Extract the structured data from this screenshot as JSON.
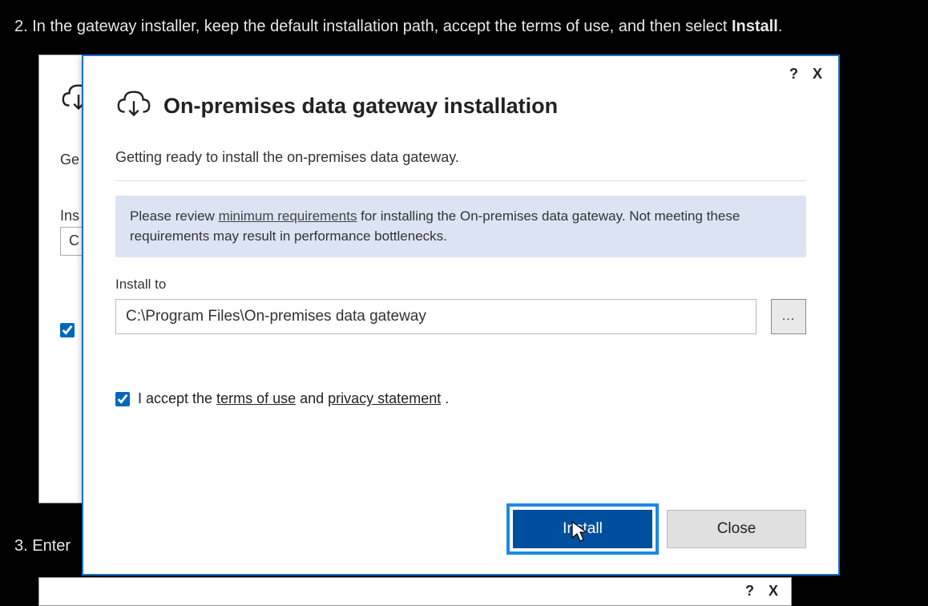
{
  "instructions": {
    "step2_prefix": "2. In the gateway installer, keep the default installation path, accept the terms of use, and then select ",
    "step2_bold": "Install",
    "step2_suffix": ".",
    "step3": "3. Enter"
  },
  "bgWindow": {
    "readyText": "Ge",
    "installLabel": "Ins",
    "pathValue": "C"
  },
  "bgWindow2": {
    "help": "?",
    "close": "X"
  },
  "dialog": {
    "titlebar": {
      "help": "?",
      "close": "X"
    },
    "title": "On-premises data gateway installation",
    "subtitle": "Getting ready to install the on-premises data gateway.",
    "info": {
      "prefix": "Please review  ",
      "link": "minimum requirements",
      "suffix": " for installing the On-premises data gateway. Not meeting these requirements may result in performance bottlenecks."
    },
    "installTo": {
      "label": "Install to",
      "path": "C:\\Program Files\\On-premises data gateway",
      "browse": "..."
    },
    "accept": {
      "prefix": "I accept the ",
      "terms": "terms of use",
      "and": " and ",
      "privacy": "privacy statement",
      "suffix": " ."
    },
    "buttons": {
      "install": "Install",
      "close": "Close"
    }
  }
}
